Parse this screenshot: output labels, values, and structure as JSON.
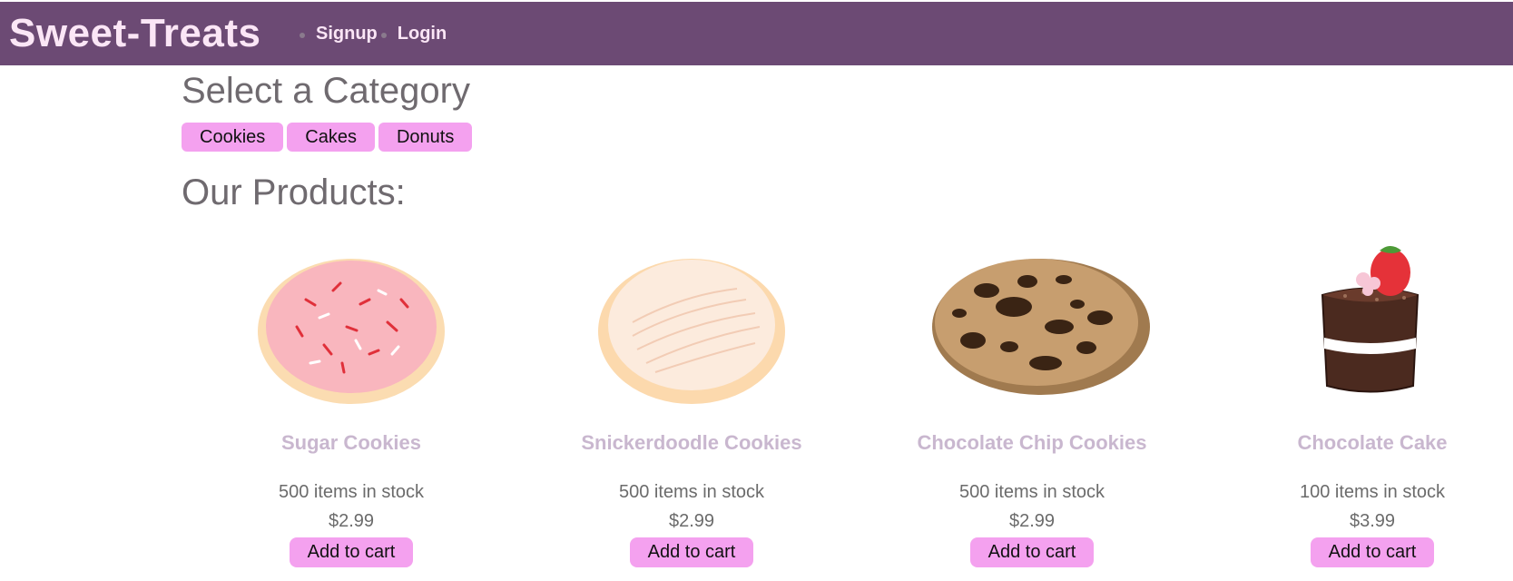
{
  "brand": {
    "name": "Sweet-Treats"
  },
  "nav": {
    "items": [
      {
        "label": "Signup"
      },
      {
        "label": "Login"
      }
    ]
  },
  "categories": {
    "title": "Select a Category",
    "items": [
      {
        "label": "Cookies"
      },
      {
        "label": "Cakes"
      },
      {
        "label": "Donuts"
      }
    ]
  },
  "products": {
    "title": "Our Products:",
    "items": [
      {
        "name": "Sugar Cookies",
        "stock": "500 items in stock",
        "price": "$2.99",
        "cta": "Add to cart",
        "image": "sugar-cookie"
      },
      {
        "name": "Snickerdoodle Cookies",
        "stock": "500 items in stock",
        "price": "$2.99",
        "cta": "Add to cart",
        "image": "snickerdoodle-cookie"
      },
      {
        "name": "Chocolate Chip Cookies",
        "stock": "500 items in stock",
        "price": "$2.99",
        "cta": "Add to cart",
        "image": "chocolate-chip-cookie"
      },
      {
        "name": "Chocolate Cake",
        "stock": "100 items in stock",
        "price": "$3.99",
        "cta": "Add to cart",
        "image": "chocolate-cake-slice"
      }
    ]
  },
  "colors": {
    "header_bg": "#6c4a74",
    "brand_text": "#fbe6f6",
    "button_bg": "#f4a1ef",
    "product_name": "#c9b7cf"
  }
}
